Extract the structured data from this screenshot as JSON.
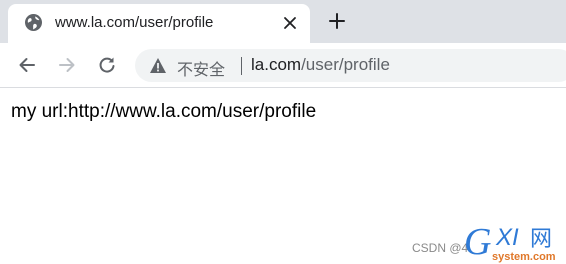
{
  "tab": {
    "title": "www.la.com/user/profile",
    "favicon_icon": "globe-icon",
    "close_icon": "close-icon"
  },
  "new_tab_icon": "plus-icon",
  "toolbar": {
    "back_icon": "arrow-left-icon",
    "forward_icon": "arrow-right-icon",
    "reload_icon": "reload-icon"
  },
  "omnibox": {
    "security_icon": "warning-icon",
    "security_label": "不安全",
    "url_host": "la.com",
    "url_path": "/user/profile"
  },
  "page": {
    "text": "my url:http://www.la.com/user/profile"
  },
  "watermark": {
    "csdn_text": "CSDN @4",
    "logo_text": "GXI网",
    "logo_subtext": "system.com"
  },
  "colors": {
    "tabstrip_bg": "#dee1e6",
    "omnibox_bg": "#f1f3f4",
    "icon_gray": "#5f6368",
    "text_dark": "#202124",
    "logo_blue": "#2f7ad6"
  }
}
